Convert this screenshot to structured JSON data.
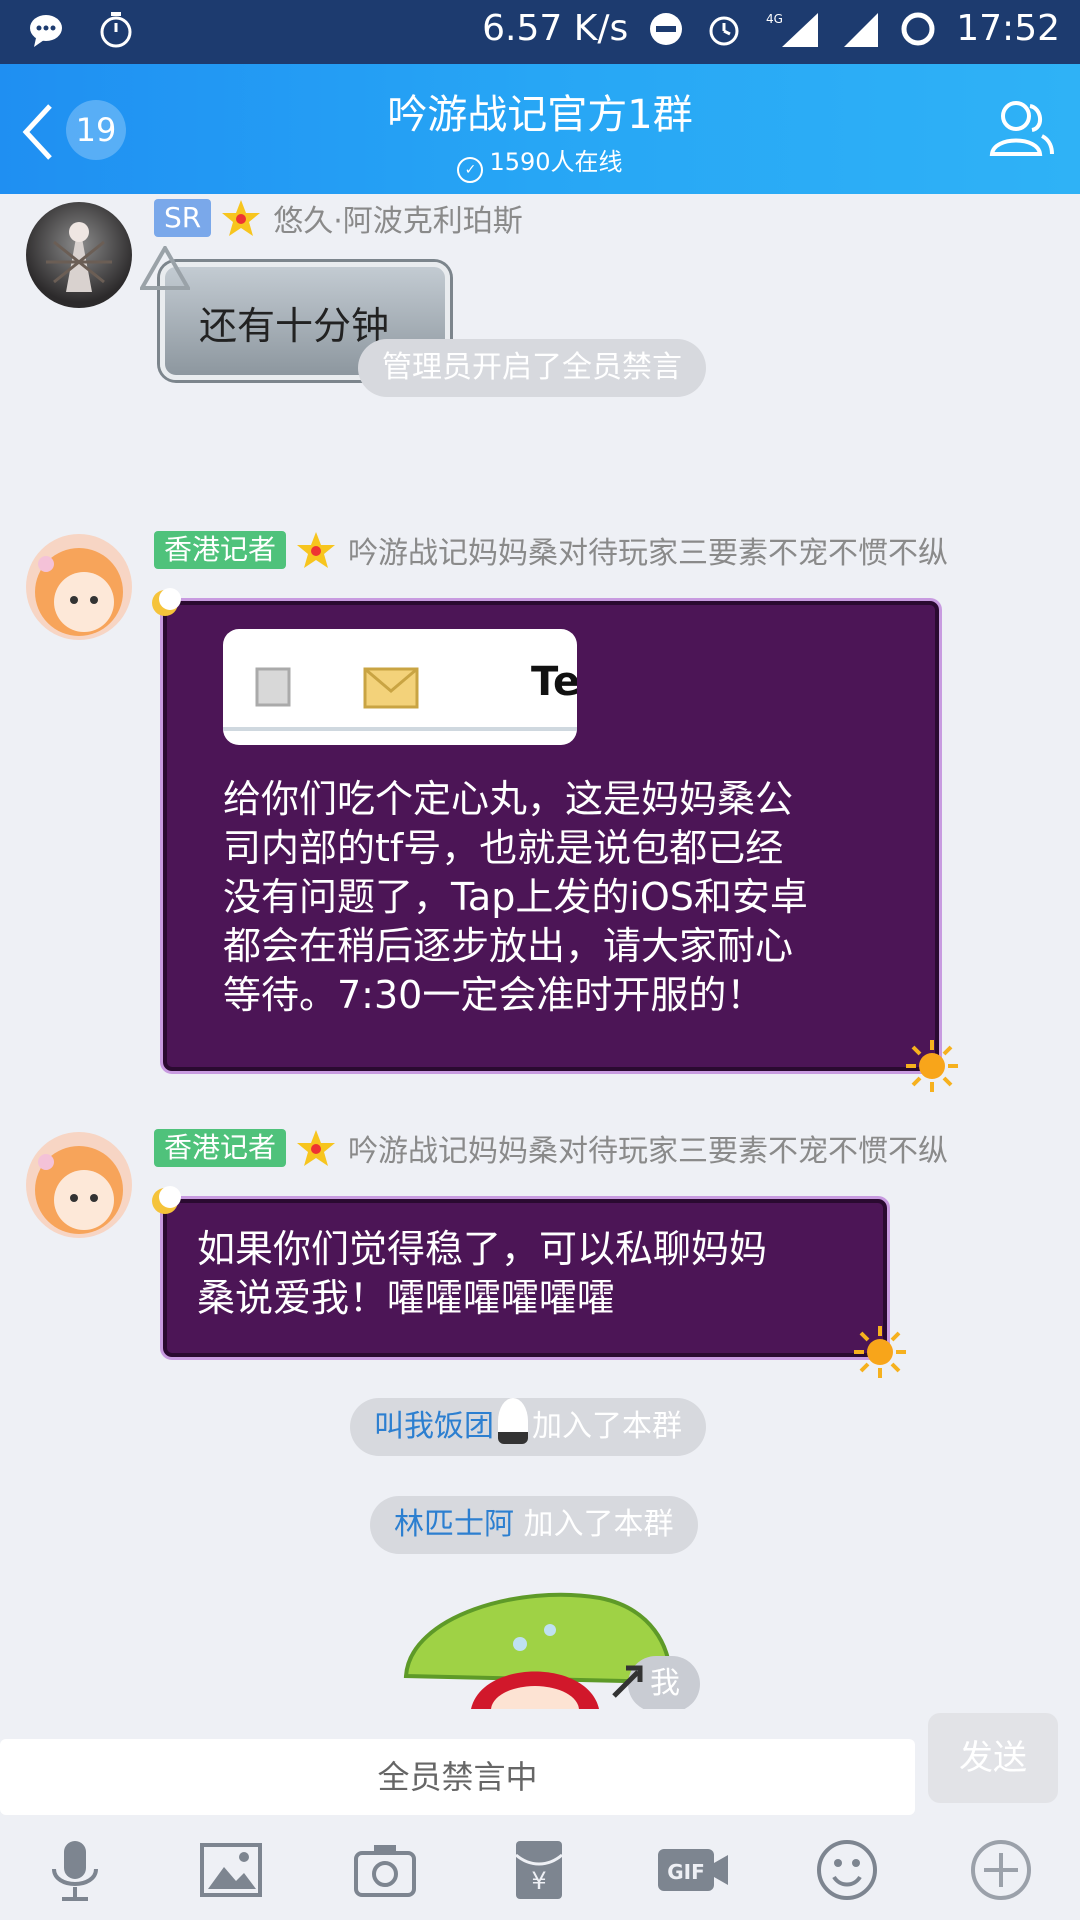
{
  "status_bar": {
    "speed": "6.57 K/s",
    "network": "4G",
    "time": "17:52"
  },
  "header": {
    "unread_count": "19",
    "title": "吟游战记官方1群",
    "online": "1590人在线"
  },
  "messages": [
    {
      "tag": "SR",
      "sender": "悠久·阿波克利珀斯",
      "text": "还有十分钟"
    },
    {
      "system": "管理员开启了全员禁言"
    },
    {
      "tag": "香港记者",
      "sender": "吟游战记妈妈桑对待玩家三要素不宠不惯不纵",
      "image_text": "Te",
      "lines": [
        "给你们吃个定心丸，这是妈妈桑公",
        "司内部的tf号，也就是说包都已经",
        "没有问题了，Tap上发的iOS和安卓",
        "都会在稍后逐步放出，请大家耐心",
        "等待。7:30一定会准时开服的！"
      ]
    },
    {
      "tag": "香港记者",
      "sender": "吟游战记妈妈桑对待玩家三要素不宠不惯不纵",
      "lines": [
        "如果你们觉得稳了，可以私聊妈妈",
        "桑说爱我！嚯嚯嚯嚯嚯嚯"
      ]
    },
    {
      "join_name": "叫我饭团",
      "join_suffix": "加入了本群"
    },
    {
      "join_name": "林匹士阿",
      "join_suffix": "加入了本群"
    },
    {
      "self_label": "我"
    }
  ],
  "input": {
    "placeholder": "全员禁言中",
    "send_label": "发送"
  },
  "toolbar": [
    "microphone-icon",
    "image-icon",
    "camera-icon",
    "red-packet-icon",
    "gif-icon",
    "emoji-icon",
    "plus-icon"
  ],
  "colors": {
    "status_bar": "#1d3b6f",
    "header": "#27a6f5",
    "chat_bg": "#eef0f5",
    "bubble_purple": "#4c1556",
    "tag_sr": "#7aa8ea",
    "tag_hk": "#4fc27b"
  }
}
